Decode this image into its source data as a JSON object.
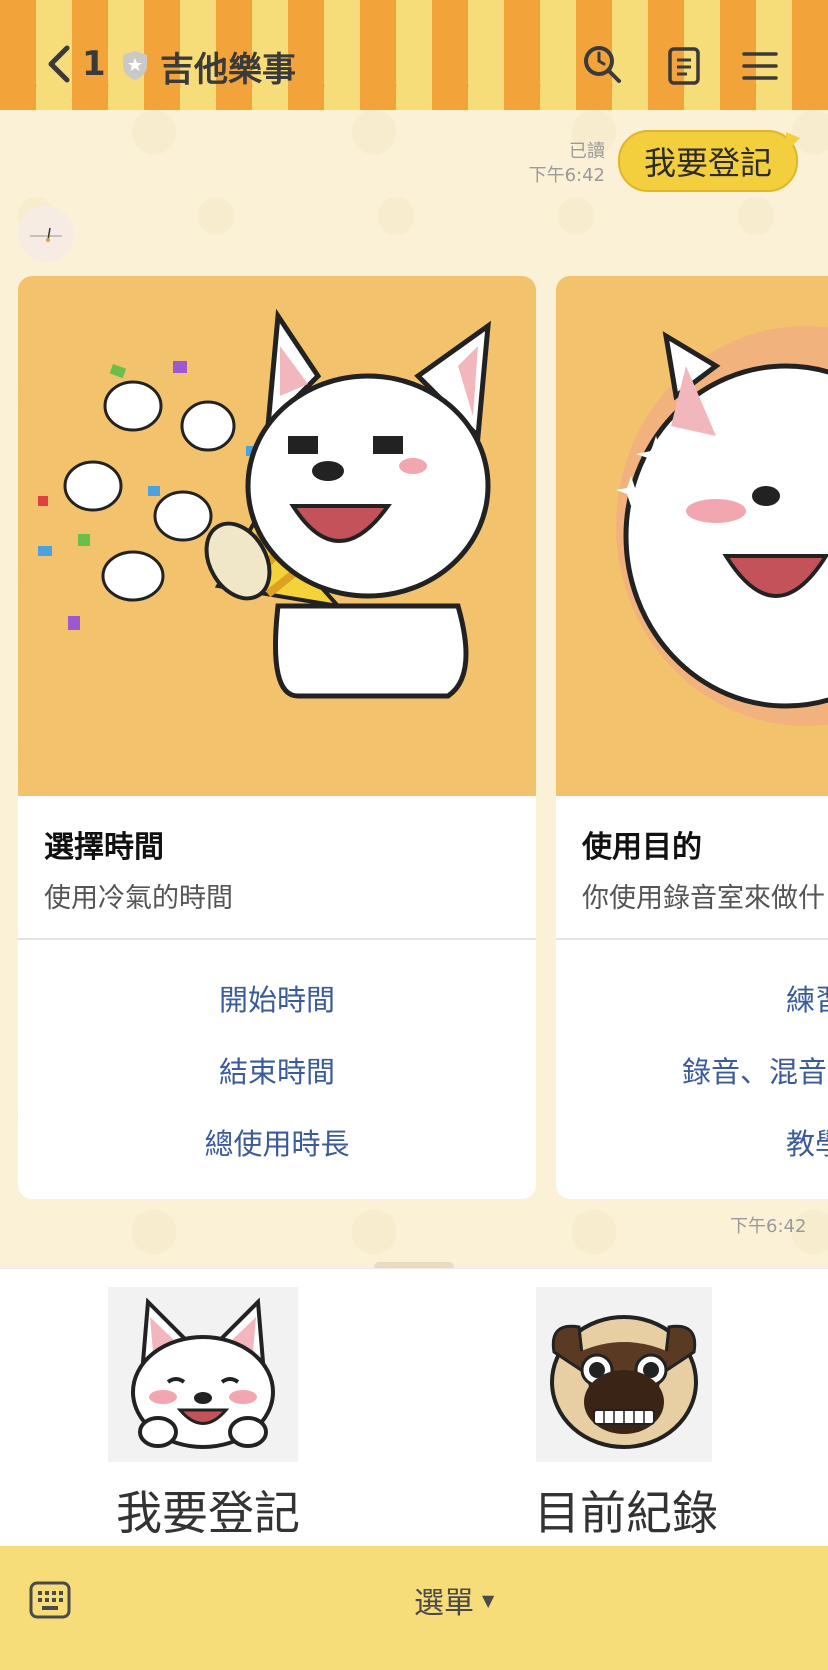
{
  "header": {
    "unread_count": "1",
    "title": "吉他樂事"
  },
  "chat": {
    "outgoing_message": "我要登記",
    "read_status": "已讀",
    "outgoing_time": "下午6:42",
    "incoming_time": "下午6:42"
  },
  "cards": [
    {
      "title": "選擇時間",
      "subtitle": "使用冷氣的時間",
      "buttons": [
        "開始時間",
        "結束時間",
        "總使用時長"
      ]
    },
    {
      "title": "使用目的",
      "subtitle": "你使用錄音室來做什",
      "buttons": [
        "練習",
        "錄音、混音",
        "教學"
      ]
    }
  ],
  "rich_menu": {
    "left_label": "我要登記",
    "right_label": "目前紀錄"
  },
  "bottom_bar": {
    "menu_label": "選單"
  },
  "colors": {
    "header_orange": "#f2a33a",
    "header_yellow": "#f7dc7a",
    "bubble": "#f3cf3e",
    "link_blue": "#3b5b9a"
  }
}
